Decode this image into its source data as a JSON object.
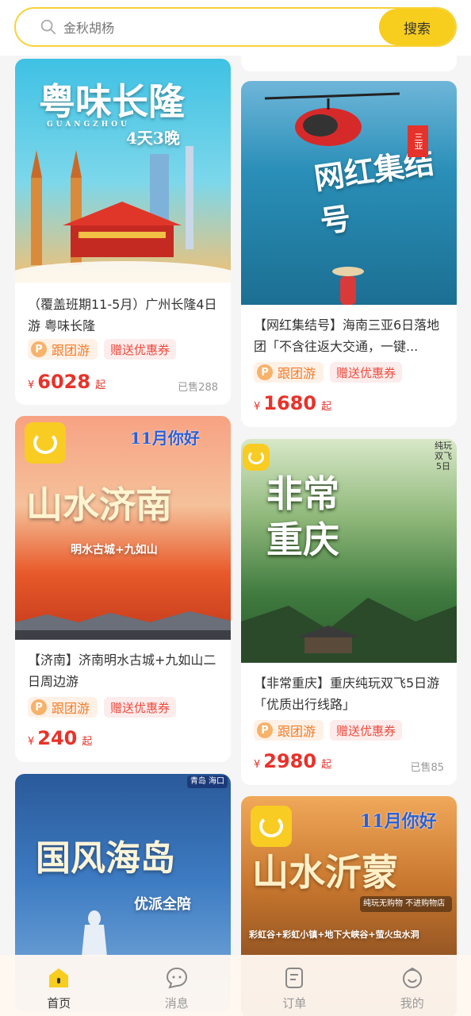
{
  "search": {
    "placeholder": "金秋胡杨",
    "button_label": "搜索"
  },
  "cards": [
    {
      "title": "（覆盖班期11-5月）广州长隆4日游 粤味长隆",
      "tag_group": "跟团游",
      "tag_coupon": "赠送优惠券",
      "currency": "¥",
      "price": "6028",
      "price_suffix": "起",
      "sold": "已售288",
      "poster": {
        "heading": "粤味长隆",
        "sub": "4天3晚",
        "en": "GUANGZHOU"
      }
    },
    {
      "title": "【网红集结号】海南三亚6日落地团「不含往返大交通，一键...",
      "tag_group": "跟团游",
      "tag_coupon": "赠送优惠券",
      "currency": "¥",
      "price": "1680",
      "price_suffix": "起",
      "poster": {
        "heading": "网红集结号",
        "badge": "三亚"
      }
    },
    {
      "title": "【济南】济南明水古城+九如山二日周边游",
      "tag_group": "跟团游",
      "tag_coupon": "赠送优惠券",
      "currency": "¥",
      "price": "240",
      "price_suffix": "起",
      "poster": {
        "heading": "山水济南",
        "sub": "明水古城+九如山",
        "top": "11月你好"
      }
    },
    {
      "title": "【非常重庆】重庆纯玩双飞5日游「优质出行线路」",
      "tag_group": "跟团游",
      "tag_coupon": "赠送优惠券",
      "currency": "¥",
      "price": "2980",
      "price_suffix": "起",
      "sold": "已售85",
      "poster": {
        "heading": "非常重庆",
        "badge": "纯玩双飞5日"
      }
    },
    {
      "title": "",
      "poster": {
        "heading": "国风海岛",
        "sub": "优派全陪",
        "badge": "青岛 海口"
      }
    },
    {
      "title": "",
      "poster": {
        "heading": "山水沂蒙",
        "top": "11月你好",
        "sub": "彩虹谷+彩虹小镇+地下大峡谷+萤火虫水洞",
        "badge": "纯玩无购物 不进购物店"
      }
    }
  ],
  "nav": [
    {
      "label": "首页",
      "icon": "home-icon",
      "active": true
    },
    {
      "label": "消息",
      "icon": "message-icon",
      "active": false
    },
    {
      "label": "订单",
      "icon": "order-icon",
      "active": false
    },
    {
      "label": "我的",
      "icon": "profile-icon",
      "active": false
    }
  ],
  "colors": {
    "accent": "#f7cd1e",
    "price": "#e8322a",
    "tag_orange": "#f07c2a"
  }
}
